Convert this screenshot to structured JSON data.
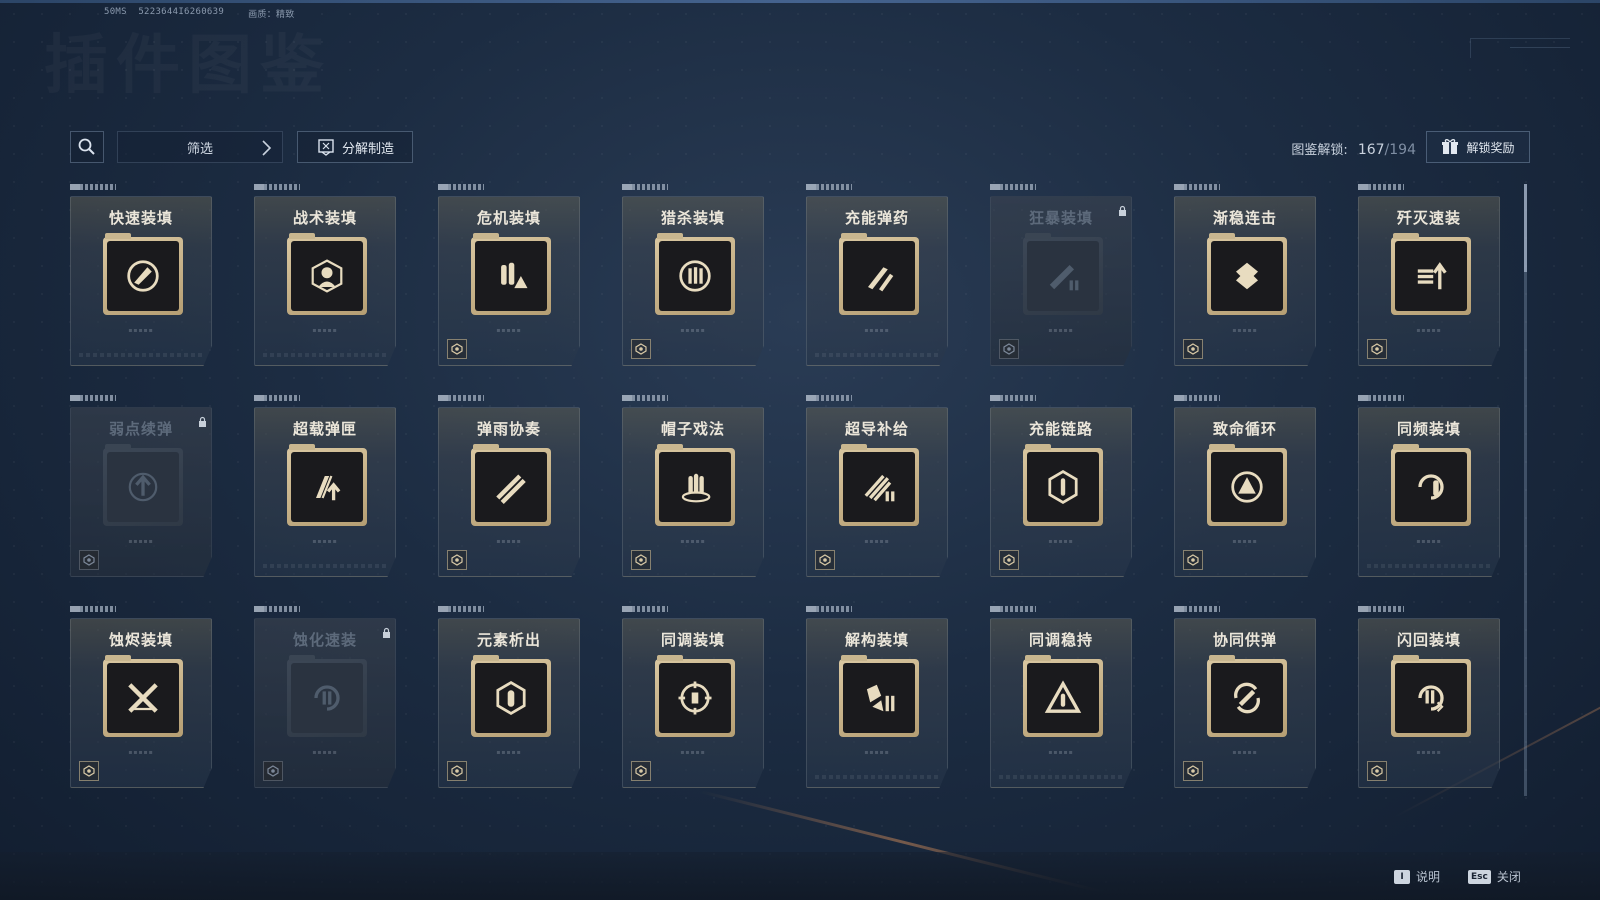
{
  "debug": {
    "fps": "50MS",
    "uid": "5223644I6260639",
    "quality": "画质：精致"
  },
  "page": {
    "title": "插件图鉴"
  },
  "toolbar": {
    "filter_label": "筛选",
    "craft_label": "分解制造",
    "unlock_label": "图鉴解锁:",
    "unlock_count": "167",
    "unlock_total": "/194",
    "reward_label": "解锁奖励"
  },
  "cards": [
    {
      "title": "快速装填",
      "icon": "bullets-arrow-circle-icon",
      "locked": false,
      "badge": false
    },
    {
      "title": "战术装填",
      "icon": "tactical-operator-icon",
      "locked": false,
      "badge": false
    },
    {
      "title": "危机装填",
      "icon": "bullets-warning-icon",
      "locked": false,
      "badge": true
    },
    {
      "title": "猎杀装填",
      "icon": "crosshair-bullets-icon",
      "locked": false,
      "badge": true
    },
    {
      "title": "充能弹药",
      "icon": "rocket-bullets-icon",
      "locked": false,
      "badge": false
    },
    {
      "title": "狂暴装填",
      "icon": "rifle-bullets-icon",
      "locked": true,
      "badge": true
    },
    {
      "title": "渐稳连击",
      "icon": "chevrons-star-icon",
      "locked": false,
      "badge": true
    },
    {
      "title": "歼灭速装",
      "icon": "bullets-up-arrow-icon",
      "locked": false,
      "badge": true
    },
    {
      "title": "弱点续弹",
      "icon": "target-up-arrow-icon",
      "locked": true,
      "badge": true
    },
    {
      "title": "超载弹匣",
      "icon": "magazine-arrow-icon",
      "locked": false,
      "badge": false
    },
    {
      "title": "弹雨协奏",
      "icon": "bullet-rain-icon",
      "locked": false,
      "badge": true
    },
    {
      "title": "帽子戏法",
      "icon": "three-bullets-icon",
      "locked": false,
      "badge": true
    },
    {
      "title": "超导补给",
      "icon": "streaks-bullets-icon",
      "locked": false,
      "badge": true
    },
    {
      "title": "充能链路",
      "icon": "hexagon-network-icon",
      "locked": false,
      "badge": true
    },
    {
      "title": "致命循环",
      "icon": "warning-cycle-icon",
      "locked": false,
      "badge": true
    },
    {
      "title": "同频装填",
      "icon": "orbit-bullet-icon",
      "locked": false,
      "badge": false
    },
    {
      "title": "蚀烬装填",
      "icon": "crossed-bullets-icon",
      "locked": false,
      "badge": true
    },
    {
      "title": "蚀化速装",
      "icon": "cycle-bullets-icon",
      "locked": true,
      "badge": true
    },
    {
      "title": "元素析出",
      "icon": "hex-bullet-icon",
      "locked": false,
      "badge": true
    },
    {
      "title": "同调装填",
      "icon": "sight-bullets-icon",
      "locked": false,
      "badge": true
    },
    {
      "title": "解构装填",
      "icon": "shards-bullets-icon",
      "locked": false,
      "badge": false
    },
    {
      "title": "同调稳持",
      "icon": "triangle-bullet-icon",
      "locked": false,
      "badge": false
    },
    {
      "title": "协同供弹",
      "icon": "sync-bullets-icon",
      "locked": false,
      "badge": true
    },
    {
      "title": "闪回装填",
      "icon": "cycle-bolt-bullets-icon",
      "locked": false,
      "badge": true
    }
  ],
  "footer": {
    "help_key": "I",
    "help_label": "说明",
    "close_key": "Esc",
    "close_label": "关闭"
  }
}
